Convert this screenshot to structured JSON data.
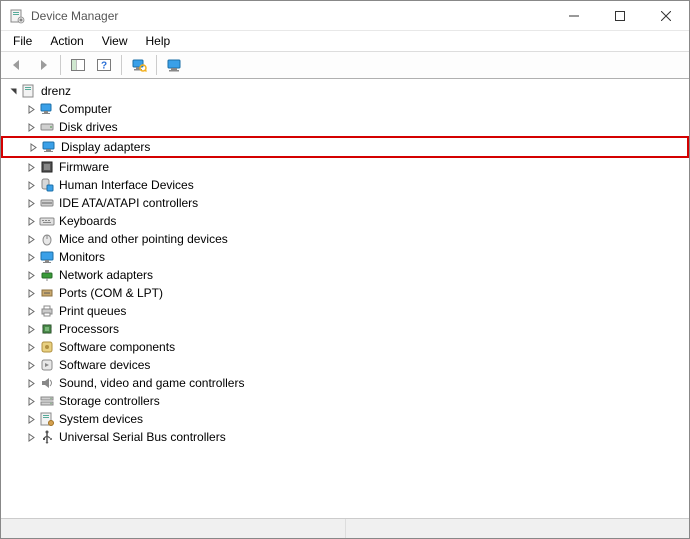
{
  "window": {
    "title": "Device Manager"
  },
  "menu": {
    "file": "File",
    "action": "Action",
    "view": "View",
    "help": "Help"
  },
  "tree": {
    "root": "drenz",
    "items": [
      {
        "label": "Computer",
        "icon": "computer"
      },
      {
        "label": "Disk drives",
        "icon": "disk"
      },
      {
        "label": "Display adapters",
        "icon": "display",
        "highlight": true
      },
      {
        "label": "Firmware",
        "icon": "firmware"
      },
      {
        "label": "Human Interface Devices",
        "icon": "hid"
      },
      {
        "label": "IDE ATA/ATAPI controllers",
        "icon": "ide"
      },
      {
        "label": "Keyboards",
        "icon": "keyboard"
      },
      {
        "label": "Mice and other pointing devices",
        "icon": "mouse"
      },
      {
        "label": "Monitors",
        "icon": "monitor"
      },
      {
        "label": "Network adapters",
        "icon": "network"
      },
      {
        "label": "Ports (COM & LPT)",
        "icon": "port"
      },
      {
        "label": "Print queues",
        "icon": "printer"
      },
      {
        "label": "Processors",
        "icon": "cpu"
      },
      {
        "label": "Software components",
        "icon": "swcomp"
      },
      {
        "label": "Software devices",
        "icon": "swdev"
      },
      {
        "label": "Sound, video and game controllers",
        "icon": "sound"
      },
      {
        "label": "Storage controllers",
        "icon": "storage"
      },
      {
        "label": "System devices",
        "icon": "system"
      },
      {
        "label": "Universal Serial Bus controllers",
        "icon": "usb"
      }
    ]
  }
}
